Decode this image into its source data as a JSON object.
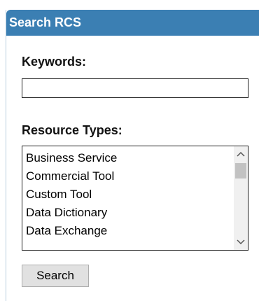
{
  "panel": {
    "title": "Search RCS",
    "header_color": "#3b7fb3"
  },
  "keywords": {
    "label": "Keywords:",
    "value": "",
    "placeholder": ""
  },
  "resource_types": {
    "label": "Resource Types:",
    "items": [
      "Business Service",
      "Commercial Tool",
      "Custom Tool",
      "Data Dictionary",
      "Data Exchange"
    ]
  },
  "scrollbar": {
    "up_icon": "chevron-up-icon",
    "down_icon": "chevron-down-icon"
  },
  "search_button": {
    "label": "Search"
  }
}
